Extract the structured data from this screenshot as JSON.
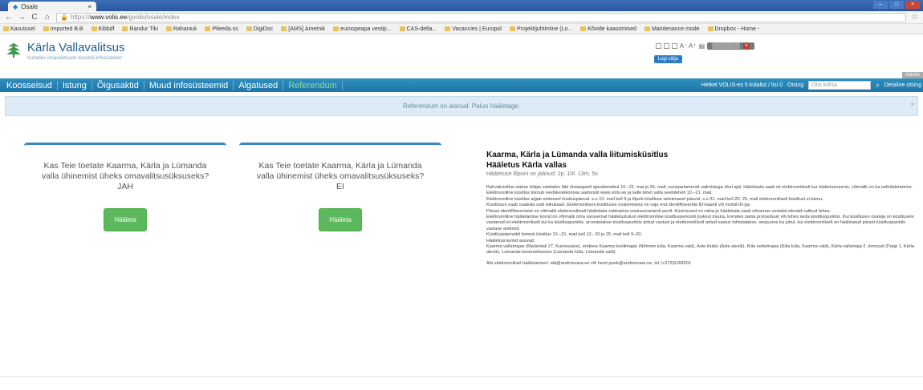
{
  "browser": {
    "tab_title": "Osale",
    "url_prefix": "https://",
    "url_host": "www.volis.ee",
    "url_path": "/gvolis/osale/index",
    "bookmarks": [
      "Kasutusel",
      "Imported B.B",
      "Kibbdf",
      "Randur Tiki",
      "Rahaniuk",
      "Pileeda.ss",
      "DigiDoc",
      "[AMS] Ametnik",
      "euroopeapa vestip...",
      "CAS-delta...",
      "Vacancies | Europol",
      "Projektijuhtimine (Lo...",
      "Kõvide kaasomised",
      "Maintenance mode",
      "Dropbox - Home -"
    ]
  },
  "site": {
    "logo_title": "Kärla Vallavalitsus",
    "logo_sub": "Kohalike omavalitsuste koostöö infosüsteem",
    "logout_label": "Logi välja",
    "corner_label": "Abiinfo"
  },
  "nav": {
    "items": [
      {
        "label": "Koosseisud"
      },
      {
        "label": "Istung"
      },
      {
        "label": "Õigusaktid"
      },
      {
        "label": "Muud infosüsteemid"
      },
      {
        "label": "Algatused"
      },
      {
        "label": "Referendum"
      }
    ],
    "status_text": "Hetkel VOLIS-es 5 külalist / lisi 0",
    "search_label": "Otsing",
    "search_placeholder": "Otsi kohta",
    "search_button": "Detailne otsing"
  },
  "notice": {
    "text": "Referendum on alanud. Palun hääletage."
  },
  "cards": [
    {
      "question": "Kas Teie toetate Kaarma, Kärla ja Lümanda valla ühinemist üheks omavalitsusüksuseks? JAH",
      "button": "Hääleta"
    },
    {
      "question": "Kas Teie toetate Kaarma, Kärla ja Lümanda valla ühinemist üheks omavalitsusüksuseks? EI",
      "button": "Hääleta"
    }
  ],
  "article": {
    "title": "Kaarma, Kärla ja Lümanda valla liitumisküsitlus",
    "subtitle": "Hääletus Kärla vallas",
    "meta": "Hääletuse lõpuni on jäänud: 2p. 10t. 13m. 5s",
    "paragraphs": [
      "Rahvaküsitlus viakse kõigis vaidades läbi üheaegselt ajavahemikul 10.–21. mai ja 25. mail; europarlamendi valimistega ühel ajal. Hääletada saab nii elektrooniliselt kui hääletusruumis, võimalik on ka eelhääletamine.",
      "Elektrooniline küsitlus toimub veebikeskkonnas aadressil www.volis.ee ja selle lehel valla veebilehelt 10.–21. mail.",
      "Elektrooniline küsitlus algab esimesel küsituspäeval. s.o 10. mail kell 9 ja lõpeb küsitluse eelviimasel päeval. s.o 21. mail kell 20. 25. mail elektrooniliselt küsitlust ei toimu.",
      "Küsitluses saab osaleda vaid isikukaart. Elektroonilises küsitluses osalemiseks on vaja end identifitseerida ID-kaardi või mobiil-ID-ga.",
      "Pärast identifitseerimist on võimalik elektrooniliselt hääletada sobivaima vastusevariandi poolt. Küsimused on näha ja hääletada saab sõnamas vesialal olevaid valikud tehes.",
      "Elektrooniline hääletamise korral on võimalik oma varasemat hääletustulust elektroonilise küsitlusperioodi jooksul muuta, korrates sama protseduuri või tehes seda küsitluspunktis. Kui küsitluses osaleja on küsitlusele vastanud nii elektrooniliselt kui ka küsitluspunktis, arvestatakse küsitluspunktis antud vastust ja elektrooniliselt antud vastus tühistatakse, seejuures ka juhul, kui elektrooniliselt on hääletatud pärast küsitluspunktis vastuse andmist.",
      "Küsitluspäevadel toimub küsitlus 10.–21. mail kell 12– 20 ja 25. mail kell 9–20.",
      "Hääletusruumid asuvad:",
      "Kaarma vallamajas (Marientali 27, Kuressaare), endises Kaarma koolimajas (Nõmme küla, Kaarma vald), Aste klubis (Aste alevik), Kiila seltsimajas (Kiila küla, Kaarma vald), Kärla vallamaja 2. korrusel (Pargi 1, Kärla alevik), Lümanda kestusehoones (Lümanda küla, Lümanda vald)."
    ],
    "contact": "Abi elektroonilisel hääletamisel: abi@andmevara.ee või henri.pook@andmevara.ee, tel (+372)5169201"
  }
}
